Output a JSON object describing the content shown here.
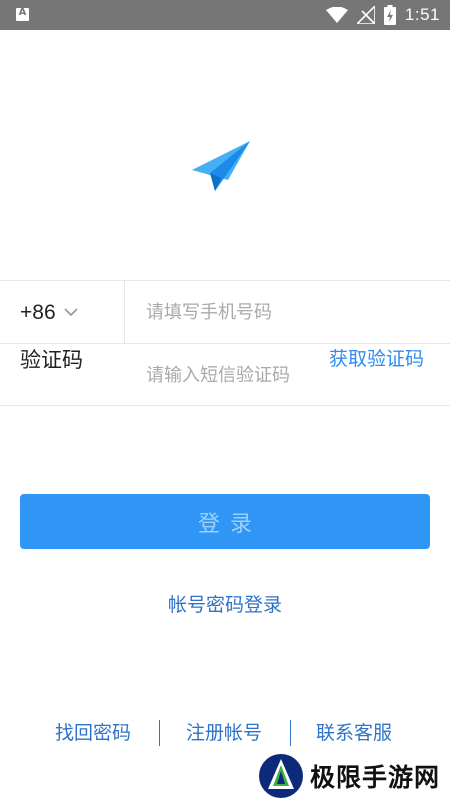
{
  "status_bar": {
    "notification_icon": "android-notification-icon",
    "notification_glyph": "A",
    "icons": [
      "wifi-icon",
      "signal-off-icon",
      "battery-charging-icon"
    ],
    "time": "1:51"
  },
  "logo": {
    "icon": "paper-plane-logo-icon",
    "color": "#2a9df4"
  },
  "phone_row": {
    "country_code": "+86",
    "country_dropdown_icon": "chevron-down-icon",
    "phone_placeholder": "请填写手机号码",
    "phone_value": ""
  },
  "code_row": {
    "label": "验证码",
    "code_placeholder": "请输入短信验证码",
    "code_value": "",
    "get_code_label": "获取验证码"
  },
  "login_button": {
    "label": "登录",
    "color": "#2f96f6",
    "text_color": "#9fd0fb"
  },
  "alt_login": {
    "label": "帐号密码登录"
  },
  "bottom_links": {
    "find_password": "找回密码",
    "register": "注册帐号",
    "contact_service": "联系客服"
  },
  "watermark": {
    "text": "极限手游网",
    "icon": "watermark-logo-icon"
  },
  "colors": {
    "accent": "#2d8cf0",
    "link": "#2f73c8",
    "status_bar": "#767676"
  }
}
